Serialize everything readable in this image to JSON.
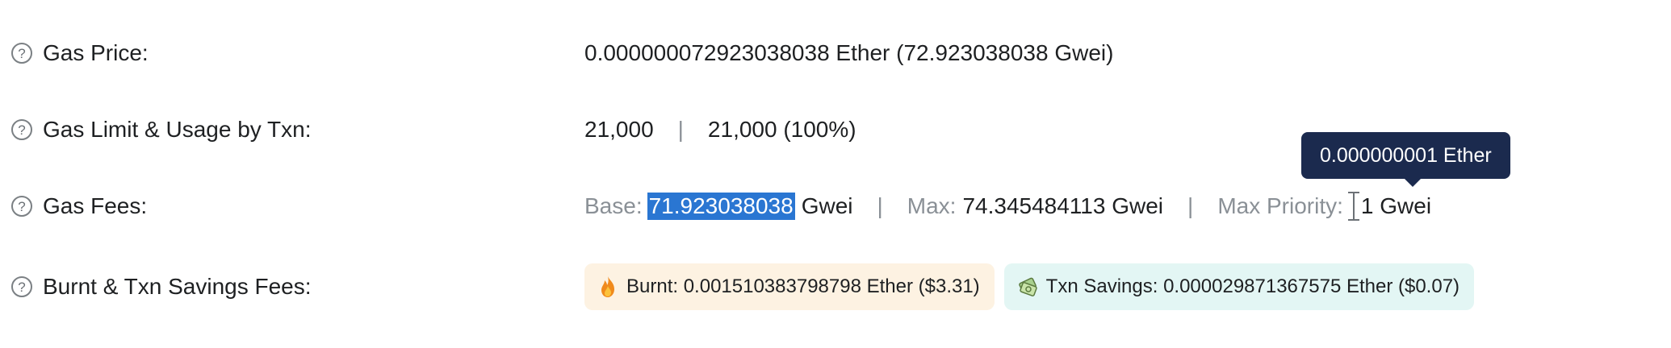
{
  "gas_price": {
    "label": "Gas Price:",
    "value": "0.000000072923038038 Ether (72.923038038 Gwei)"
  },
  "gas_limit": {
    "label": "Gas Limit & Usage by Txn:",
    "limit": "21,000",
    "separator": "|",
    "usage": "21,000 (100%)"
  },
  "gas_fees": {
    "label": "Gas Fees:",
    "base_label": "Base:",
    "base_value": "71.923038038",
    "base_unit": "Gwei",
    "separator": "|",
    "max_label": "Max:",
    "max_value": "74.345484113 Gwei",
    "max_priority_label": "Max Priority:",
    "max_priority_value": "1 Gwei"
  },
  "tooltip": {
    "text": "0.000000001 Ether"
  },
  "burnt_savings": {
    "label": "Burnt & Txn Savings Fees:",
    "burnt_text": "Burnt: 0.001510383798798 Ether ($3.31)",
    "savings_text": "Txn Savings: 0.000029871367575 Ether ($0.07)"
  },
  "icons": {
    "help": "question-circle-icon",
    "burnt": "flame-icon",
    "savings": "money-bills-icon"
  },
  "colors": {
    "selection": "#2a76d2",
    "tooltip_bg": "#1b2a4e",
    "burnt_bg": "#fdf2e2",
    "savings_bg": "#e3f6f4",
    "muted_text": "#8a9096"
  }
}
